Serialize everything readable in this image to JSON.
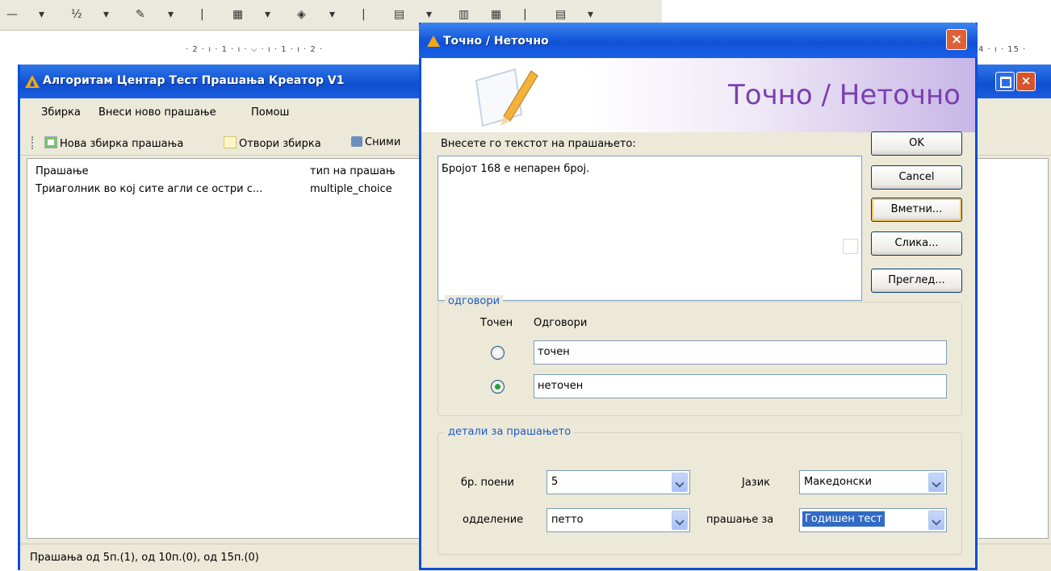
{
  "word": {
    "toolbar_glyphs": [
      "—",
      "▾",
      "½",
      "▾",
      "✎",
      "▾",
      "|",
      "▦",
      "▾",
      "◈",
      "▾",
      "|",
      "▤",
      "▾",
      "▥",
      "▦",
      "|",
      "▤",
      "▾"
    ],
    "ruler_text": "· 2 · ı · 1 · ı · ⌵ · ı · 1 · ı · 2 ·",
    "ruler_text_right": "4 · ı · 15 ·"
  },
  "app": {
    "title": "Алгоритам Центар Тест Прашања Креатор V1",
    "menu": [
      "Збирка",
      "Внеси ново прашање",
      "Помош"
    ],
    "toolbar": [
      "Нова збирка прашања",
      "Отвори збирка",
      "Сними"
    ],
    "list": {
      "columns": [
        "Прашање",
        "тип на прашањ"
      ],
      "rows": [
        [
          "Триаголник во кој сите агли се остри с...",
          "multiple_choice"
        ]
      ]
    },
    "status": "Прашања од 5п.(1), од 10п.(0), од 15п.(0)"
  },
  "dialog": {
    "title": "Точно / Неточно",
    "banner": "Точно / Неточно",
    "prompt_label": "Внесете го текстот на прашањето:",
    "question_text": "Бројот 168 е непарен број.",
    "buttons": {
      "ok": "OK",
      "cancel": "Cancel",
      "insert": "Вметни...",
      "image": "Слика...",
      "preview": "Преглед..."
    },
    "answers": {
      "legend": "одговори",
      "col_correct": "Точен",
      "col_answers": "Одговори",
      "items": [
        {
          "text": "точен",
          "selected": false
        },
        {
          "text": "неточен",
          "selected": true
        }
      ]
    },
    "details": {
      "legend": "детали за прашањето",
      "points_label": "бр. поени",
      "points_value": "5",
      "language_label": "Јазик",
      "language_value": "Македонски",
      "grade_label": "одделение",
      "grade_value": "петто",
      "question_for_label": "прашање за",
      "question_for_value": "Годишен тест"
    }
  }
}
